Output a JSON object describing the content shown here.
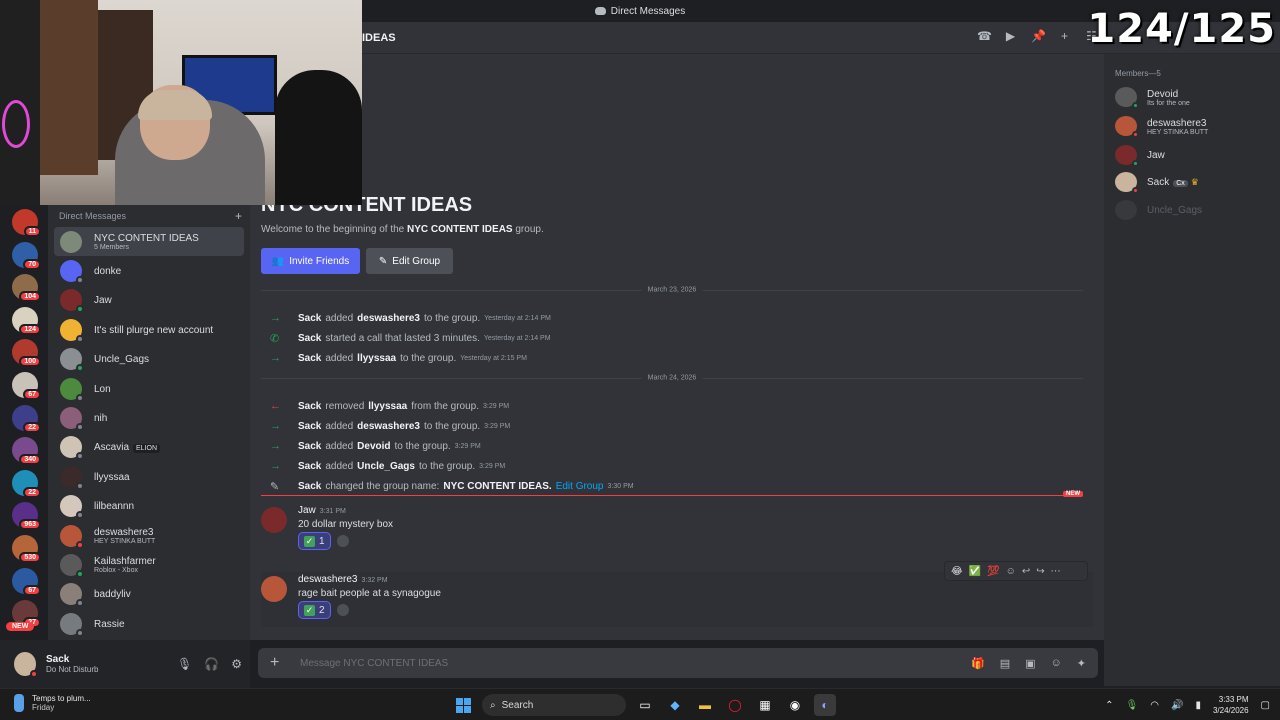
{
  "window": {
    "title": "Direct Messages"
  },
  "overlay": {
    "counter": "124/125"
  },
  "rail": {
    "servers": [
      {
        "color": "#c0392b",
        "badge": "11"
      },
      {
        "color": "#2f5fa6",
        "badge": "70"
      },
      {
        "color": "#8e6c4a",
        "badge": "104"
      },
      {
        "color": "#d9d2c0",
        "badge": "124"
      },
      {
        "color": "#b03a2e",
        "badge": "100"
      },
      {
        "color": "#c9c2b8",
        "badge": "67"
      },
      {
        "color": "#3d3f8a",
        "badge": "22"
      },
      {
        "color": "#7a4a8f",
        "badge": "340"
      },
      {
        "color": "#1f8fb8",
        "badge": "22"
      },
      {
        "color": "#5a2f8a",
        "badge": "963"
      },
      {
        "color": "#b5653a",
        "badge": "530"
      },
      {
        "color": "#2c5aa0",
        "badge": "67"
      },
      {
        "color": "#6a3a3a",
        "badge": "27"
      }
    ],
    "new_label": "NEW"
  },
  "dm_sidebar": {
    "header": "Direct Messages",
    "items": [
      {
        "name": "NYC CONTENT IDEAS",
        "sub": "5 Members",
        "color": "#7d8a7a",
        "status": "",
        "selected": true
      },
      {
        "name": "donke",
        "sub": "",
        "color": "#5865f2",
        "status": "#80848e"
      },
      {
        "name": "Jaw",
        "sub": "",
        "color": "#7a2a2a",
        "status": "#23a55a"
      },
      {
        "name": "It's still plurge new account",
        "sub": "",
        "color": "#f0b232",
        "status": "#80848e"
      },
      {
        "name": "Uncle_Gags",
        "sub": "",
        "color": "#8a8f93",
        "status": "#23a55a"
      },
      {
        "name": "Lon",
        "sub": "",
        "color": "#4c8a3e",
        "status": "#80848e"
      },
      {
        "name": "nih",
        "sub": "",
        "color": "#8b5e7a",
        "status": "#80848e"
      },
      {
        "name": "Ascavia",
        "sub": "",
        "color": "#cfc3b5",
        "status": "#80848e",
        "tag": "ELION"
      },
      {
        "name": "llyyssaa",
        "sub": "",
        "color": "#3a2a2a",
        "status": "#80848e"
      },
      {
        "name": "lilbeannn",
        "sub": "",
        "color": "#d4c8bc",
        "status": "#80848e"
      },
      {
        "name": "deswashere3",
        "sub": "HEY STINKA BUTT",
        "color": "#b8563a",
        "status": "#f23f42"
      },
      {
        "name": "Kailashfarmer",
        "sub": "Roblox - Xbox",
        "color": "#5a5a5a",
        "status": "#23a55a"
      },
      {
        "name": "baddyliv",
        "sub": "",
        "color": "#8a8079",
        "status": "#80848e"
      },
      {
        "name": "Rassie",
        "sub": "",
        "color": "#777b80",
        "status": "#80848e"
      }
    ]
  },
  "user_panel": {
    "name": "Sack",
    "status": "Do Not Disturb"
  },
  "channel": {
    "header_name": "IDEAS",
    "title": "NYC CONTENT IDEAS",
    "welcome_prefix": "Welcome to the beginning of the ",
    "welcome_group": "NYC CONTENT IDEAS",
    "welcome_suffix": " group.",
    "invite_label": "Invite Friends",
    "edit_label": "Edit Group",
    "dates": [
      "March 23, 2026",
      "March 24, 2026"
    ],
    "events": [
      {
        "kind": "join",
        "actor": "Sack",
        "verb": "added",
        "target": "deswashere3",
        "tail": "to the group.",
        "time": "Yesterday at 2:14 PM"
      },
      {
        "kind": "call",
        "actor": "Sack",
        "verb": "started a call that lasted 3 minutes.",
        "target": "",
        "tail": "",
        "time": "Yesterday at 2:14 PM"
      },
      {
        "kind": "join",
        "actor": "Sack",
        "verb": "added",
        "target": "llyyssaa",
        "tail": "to the group.",
        "time": "Yesterday at 2:15 PM"
      },
      {
        "kind": "leave",
        "actor": "Sack",
        "verb": "removed",
        "target": "llyyssaa",
        "tail": "from the group.",
        "time": "3:29 PM"
      },
      {
        "kind": "join",
        "actor": "Sack",
        "verb": "added",
        "target": "deswashere3",
        "tail": "to the group.",
        "time": "3:29 PM"
      },
      {
        "kind": "join",
        "actor": "Sack",
        "verb": "added",
        "target": "Devoid",
        "tail": "to the group.",
        "time": "3:29 PM"
      },
      {
        "kind": "join",
        "actor": "Sack",
        "verb": "added",
        "target": "Uncle_Gags",
        "tail": "to the group.",
        "time": "3:29 PM"
      },
      {
        "kind": "rename",
        "actor": "Sack",
        "verb": "changed the group name:",
        "target": "NYC CONTENT IDEAS.",
        "link": "Edit Group",
        "time": "3:30 PM"
      }
    ],
    "new_label": "NEW",
    "messages": [
      {
        "author": "Jaw",
        "time": "3:31 PM",
        "text": "20 dollar mystery box",
        "reaction_count": "1",
        "color": "#7a2a2a"
      },
      {
        "author": "deswashere3",
        "time": "3:32 PM",
        "text": "rage bait people at a synagogue",
        "reaction_count": "2",
        "color": "#b8563a"
      }
    ],
    "hover_emojis": [
      "😂",
      "✅",
      "💯"
    ],
    "composer_placeholder": "Message NYC CONTENT IDEAS"
  },
  "members": {
    "header": "Members—5",
    "list": [
      {
        "name": "Devoid",
        "sub": "Its for the one",
        "color": "#5a5a5a",
        "status": "#23a55a",
        "online": true
      },
      {
        "name": "deswashere3",
        "sub": "HEY STINKA BUTT",
        "color": "#b8563a",
        "status": "#f23f42",
        "online": true
      },
      {
        "name": "Jaw",
        "sub": "",
        "color": "#7a2a2a",
        "status": "#23a55a",
        "online": true
      },
      {
        "name": "Sack",
        "sub": "",
        "color": "#c9b59d",
        "status": "#f23f42",
        "online": true,
        "tag": "Cx",
        "owner": true
      },
      {
        "name": "Uncle_Gags",
        "sub": "",
        "color": "#4a4c50",
        "status": "",
        "online": false
      }
    ]
  },
  "taskbar": {
    "weather_title": "Temps to plum...",
    "weather_sub": "Friday",
    "search_label": "Search",
    "time": "3:33 PM",
    "date": "3/24/2026"
  }
}
